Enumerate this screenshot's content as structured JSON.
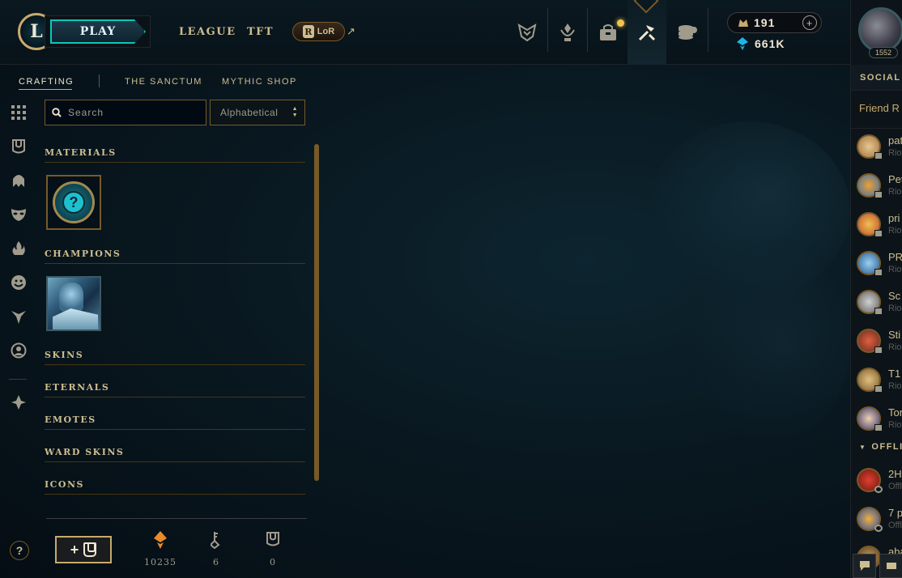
{
  "topnav": {
    "logo_letter": "L",
    "play_label": "PLAY",
    "links": [
      "LEAGUE",
      "TFT"
    ],
    "lor_badge": "R",
    "lor_label": "LoR",
    "external_icon": "↗",
    "icons": [
      "clash-icon",
      "ranked-icon",
      "store-icon",
      "crafting-icon",
      "loot-icon"
    ],
    "active_icon": "crafting-icon"
  },
  "currency": {
    "rp": "191",
    "rp_plus": "+",
    "blue_essence": "661K"
  },
  "profile": {
    "level": "1552"
  },
  "subnav": {
    "tabs": [
      "CRAFTING",
      "THE SANCTUM",
      "MYTHIC SHOP"
    ],
    "active": "CRAFTING"
  },
  "filters": {
    "search_placeholder": "Search",
    "sort_value": "Alphabetical"
  },
  "categories": {
    "materials": "MATERIALS",
    "champions": "CHAMPIONS",
    "skins": "SKINS",
    "eternals": "ETERNALS",
    "emotes": "EMOTES",
    "ward_skins": "WARD SKINS",
    "icons": "ICONS"
  },
  "bottom": {
    "add_chest_plus": "+",
    "orange_essence": "10235",
    "keys": "6",
    "chests": "0"
  },
  "help_label": "?",
  "social": {
    "header": "SOCIAL",
    "friend_requests": "Friend R",
    "online": [
      {
        "name": "pat",
        "sub": "Rio"
      },
      {
        "name": "Pet",
        "sub": "Rio"
      },
      {
        "name": "pri",
        "sub": "Rio"
      },
      {
        "name": "PR",
        "sub": "Rio"
      },
      {
        "name": "Sc",
        "sub": "Rio"
      },
      {
        "name": "Sti",
        "sub": "Rio"
      },
      {
        "name": "T1",
        "sub": "Rio"
      },
      {
        "name": "Tor",
        "sub": "Rio"
      }
    ],
    "offline_header": "OFFLI",
    "offline": [
      {
        "name": "2H",
        "sub": "Offl"
      },
      {
        "name": "7 p",
        "sub": "Offl"
      },
      {
        "name": "aba",
        "sub": ""
      }
    ]
  },
  "colors": {
    "gold": "#c8aa6e",
    "gold_dark": "#785a28",
    "teal": "#0ac8b9",
    "text": "#a09b8c",
    "orange": "#e88a2c"
  }
}
